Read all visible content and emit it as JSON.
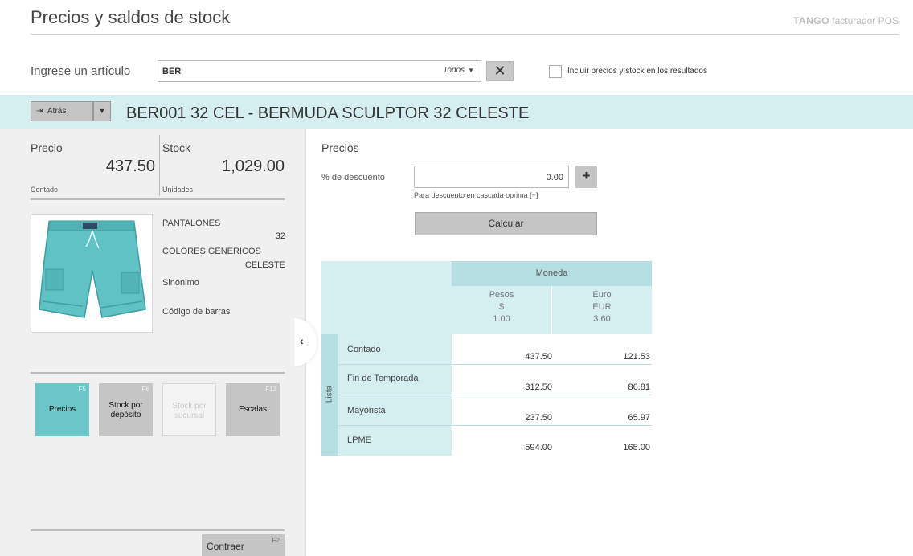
{
  "header": {
    "title": "Precios y saldos de stock",
    "brand_logo": "TANGO",
    "brand_text": "facturador POS"
  },
  "search": {
    "label": "Ingrese un artículo",
    "value": "BER",
    "filter": "Todos",
    "include_label": "Incluir precios y stock en los resultados",
    "include_checked": false
  },
  "article": {
    "back_label": "Atrás",
    "title": "BER001   32 CEL - BERMUDA SCULPTOR 32 CELESTE"
  },
  "summary": {
    "price_label": "Precio",
    "price_value": "437.50",
    "price_sub": "Contado",
    "stock_label": "Stock",
    "stock_value": "1,029.00",
    "stock_sub": "Unidades"
  },
  "attributes": {
    "category": "PANTALONES",
    "size": "32",
    "color_group": "COLORES GENERICOS",
    "color": "CELESTE",
    "synonym_label": "Sinónimo",
    "barcode_label": "Código de barras"
  },
  "tiles": [
    {
      "label": "Precios",
      "key": "F5",
      "active": true
    },
    {
      "label": "Stock por depósito",
      "key": "F6",
      "active": false
    },
    {
      "label": "Stock por sucursal",
      "key": "",
      "active": false,
      "disabled": true
    },
    {
      "label": "Escalas",
      "key": "F12",
      "active": false
    }
  ],
  "footer": {
    "collapse_label": "Contraer",
    "collapse_key": "F2"
  },
  "prices": {
    "title": "Precios",
    "discount_label": "% de descuento",
    "discount_value": "0.00",
    "discount_hint": "Para descuento en cascada oprima [+]",
    "calc_label": "Calcular",
    "table": {
      "currency_header": "Moneda",
      "row_group_label": "Lista",
      "currencies": [
        {
          "name": "Pesos",
          "symbol": "$",
          "rate": "1.00"
        },
        {
          "name": "Euro",
          "symbol": "EUR",
          "rate": "3.60"
        }
      ],
      "rows": [
        {
          "list": "Contado",
          "values": [
            "437.50",
            "121.53"
          ]
        },
        {
          "list": "Fin de Temporada",
          "values": [
            "312.50",
            "86.81"
          ]
        },
        {
          "list": "Mayorista",
          "values": [
            "237.50",
            "65.97"
          ]
        },
        {
          "list": "LPME",
          "values": [
            "594.00",
            "165.00"
          ]
        }
      ]
    }
  },
  "colors": {
    "accent_teal": "#6cc5c6",
    "bar_bg": "#d5eef0",
    "panel_bg": "#f0f0f0"
  }
}
